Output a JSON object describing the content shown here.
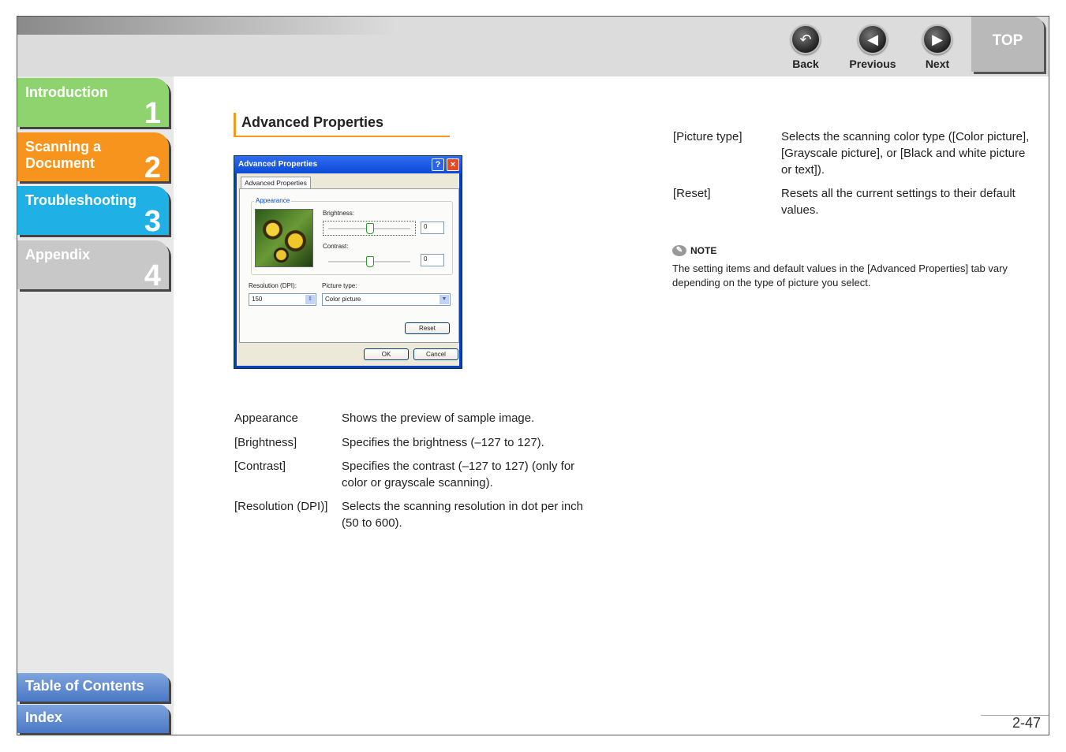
{
  "nav": {
    "back": "Back",
    "previous": "Previous",
    "next": "Next",
    "top": "TOP"
  },
  "sidebar": {
    "chapters": [
      {
        "label": "Introduction",
        "number": "1",
        "color": "#8ed36d"
      },
      {
        "label": "Scanning a Document",
        "number": "2",
        "color": "#f7941d"
      },
      {
        "label": "Troubleshooting",
        "number": "3",
        "color": "#1fb1e6"
      },
      {
        "label": "Appendix",
        "number": "4",
        "color": "#c8c8c8"
      }
    ],
    "toc": "Table of Contents",
    "index": "Index"
  },
  "section_title": "Advanced Properties",
  "dialog": {
    "title": "Advanced Properties",
    "help_btn": "?",
    "close_btn": "×",
    "tab": "Advanced Properties",
    "appearance_legend": "Appearance",
    "brightness_label": "Brightness:",
    "brightness_value": "0",
    "contrast_label": "Contrast:",
    "contrast_value": "0",
    "resolution_label": "Resolution (DPI):",
    "resolution_value": "150",
    "picture_type_label": "Picture type:",
    "picture_type_value": "Color picture",
    "reset_btn": "Reset",
    "ok_btn": "OK",
    "cancel_btn": "Cancel"
  },
  "left_items": [
    {
      "term": "Appearance",
      "desc": "Shows the preview of sample image."
    },
    {
      "term": "[Brightness]",
      "desc": "Specifies the brightness (–127 to 127)."
    },
    {
      "term": "[Contrast]",
      "desc": "Specifies the contrast (–127 to 127) (only for color or grayscale scanning)."
    },
    {
      "term": "[Resolution (DPI)]",
      "desc": "Selects the scanning resolution in dot per inch (50 to 600)."
    }
  ],
  "right_items": [
    {
      "term": "[Picture type]",
      "desc": "Selects the scanning color type ([Color picture], [Grayscale picture], or [Black and white picture or text])."
    },
    {
      "term": "[Reset]",
      "desc": "Resets all the current settings to their default values."
    }
  ],
  "note": {
    "heading": "NOTE",
    "text": "The setting items and default values in the [Advanced Properties] tab vary depending on the type of picture you select."
  },
  "page_number": "2-47"
}
